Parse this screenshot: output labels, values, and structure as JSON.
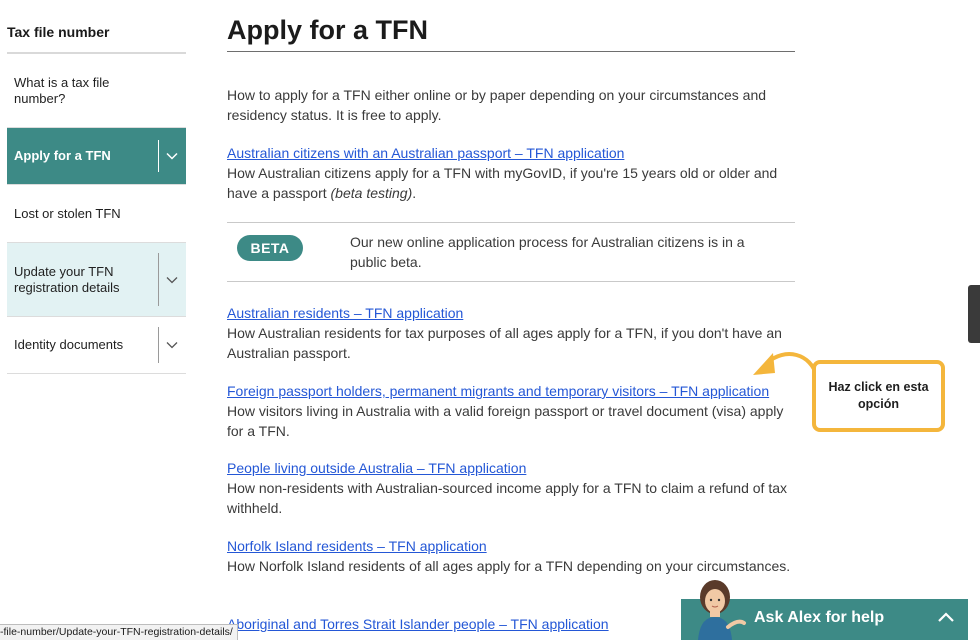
{
  "sidebar": {
    "title": "Tax file number",
    "items": [
      {
        "label": "What is a tax file number?"
      },
      {
        "label": "Apply for a TFN"
      },
      {
        "label": "Lost or stolen TFN"
      },
      {
        "label": "Update your TFN registration details"
      },
      {
        "label": "Identity documents"
      }
    ]
  },
  "main": {
    "title": "Apply for a TFN",
    "intro": "How to apply for a TFN either online or by paper depending on your circumstances and residency status. It is free to apply.",
    "sections": [
      {
        "link": "Australian citizens with an Australian passport – TFN application",
        "desc_pre": "How Australian citizens apply for a TFN with myGovID, if you're 15  years old or older and have a passport ",
        "desc_em": "(beta testing)",
        "desc_post": "."
      },
      {
        "link": "Australian residents – TFN application",
        "desc": "How Australian residents for tax purposes of all ages apply for a TFN, if you don't have an Australian passport."
      },
      {
        "link": "Foreign passport holders, permanent migrants and temporary visitors – TFN application",
        "desc": "How visitors living in Australia with a valid foreign passport or travel document (visa) apply for a TFN."
      },
      {
        "link": "People living outside Australia – TFN application",
        "desc": "How non-residents with Australian-sourced income apply for a TFN to claim a refund of tax withheld."
      },
      {
        "link": "Norfolk Island residents – TFN application",
        "desc": "How Norfolk Island residents of all ages apply for a TFN depending on your circumstances."
      },
      {
        "link": "Aboriginal and Torres Strait Islander people – TFN application"
      }
    ],
    "beta": {
      "badge": "BETA",
      "text": "Our new online application process for Australian citizens is in a public beta."
    }
  },
  "callout": {
    "text": "Haz click en esta opción"
  },
  "status_bar": {
    "url": "-file-number/Update-your-TFN-registration-details/"
  },
  "help": {
    "label": "Ask Alex for help"
  },
  "colors": {
    "teal": "#3d8a86",
    "link": "#2457d6",
    "callout_border": "#f4b63c"
  }
}
